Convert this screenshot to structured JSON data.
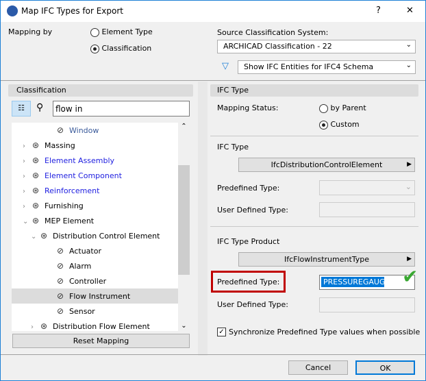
{
  "title": "Map IFC Types for Export",
  "mapping_by": {
    "label": "Mapping by",
    "options": [
      "Element Type",
      "Classification"
    ],
    "selected": "Classification"
  },
  "source": {
    "label": "Source Classification System:",
    "value": "ARCHICAD Classification - 22",
    "filter": "Show IFC Entities for IFC4 Schema"
  },
  "left": {
    "header": "Classification",
    "search": "flow in",
    "reset": "Reset Mapping",
    "items": [
      {
        "label": "Window",
        "level": 2,
        "arrow": "",
        "blue": false,
        "icon": "leaf-crossed-icon"
      },
      {
        "label": "Massing",
        "level": 0,
        "arrow": "right",
        "blue": false,
        "icon": "classification-icon"
      },
      {
        "label": "Element Assembly",
        "level": 0,
        "arrow": "right",
        "blue": true,
        "icon": "classification-icon"
      },
      {
        "label": "Element Component",
        "level": 0,
        "arrow": "right",
        "blue": true,
        "icon": "classification-icon"
      },
      {
        "label": "Reinforcement",
        "level": 0,
        "arrow": "right",
        "blue": true,
        "icon": "classification-icon"
      },
      {
        "label": "Furnishing",
        "level": 0,
        "arrow": "right",
        "blue": false,
        "icon": "classification-icon"
      },
      {
        "label": "MEP Element",
        "level": 0,
        "arrow": "down",
        "blue": false,
        "icon": "classification-icon"
      },
      {
        "label": "Distribution Control Element",
        "level": 1,
        "arrow": "down",
        "blue": false,
        "icon": "classification-icon"
      },
      {
        "label": "Actuator",
        "level": 2,
        "arrow": "",
        "blue": false,
        "icon": "leaf-crossed-icon"
      },
      {
        "label": "Alarm",
        "level": 2,
        "arrow": "",
        "blue": false,
        "icon": "leaf-crossed-icon"
      },
      {
        "label": "Controller",
        "level": 2,
        "arrow": "",
        "blue": false,
        "icon": "leaf-crossed-icon"
      },
      {
        "label": "Flow Instrument",
        "level": 2,
        "arrow": "",
        "blue": false,
        "icon": "leaf-crossed-icon",
        "selected": true
      },
      {
        "label": "Sensor",
        "level": 2,
        "arrow": "",
        "blue": false,
        "icon": "leaf-crossed-icon"
      },
      {
        "label": "Distribution Flow Element",
        "level": 1,
        "arrow": "right",
        "blue": false,
        "icon": "classification-icon"
      }
    ]
  },
  "right": {
    "header": "IFC Type",
    "mapping_status": "Mapping Status:",
    "by_parent": "by Parent",
    "custom": "Custom",
    "ifc_type_label": "IFC Type",
    "ifc_type": "IfcDistributionControlElement",
    "predefined": "Predefined Type:",
    "user_defined": "User Defined Type:",
    "product_label": "IFC Type Product",
    "product": "IfcFlowInstrumentType",
    "product_predefined": "PRESSUREGAUGE",
    "sync": "Synchronize Predefined Type values when possible"
  },
  "buttons": {
    "cancel": "Cancel",
    "ok": "OK",
    "help": "?",
    "close": "✕"
  },
  "colors": {
    "highlight_border": "#c00000",
    "selection": "#0078d7",
    "check": "#3aa832"
  }
}
